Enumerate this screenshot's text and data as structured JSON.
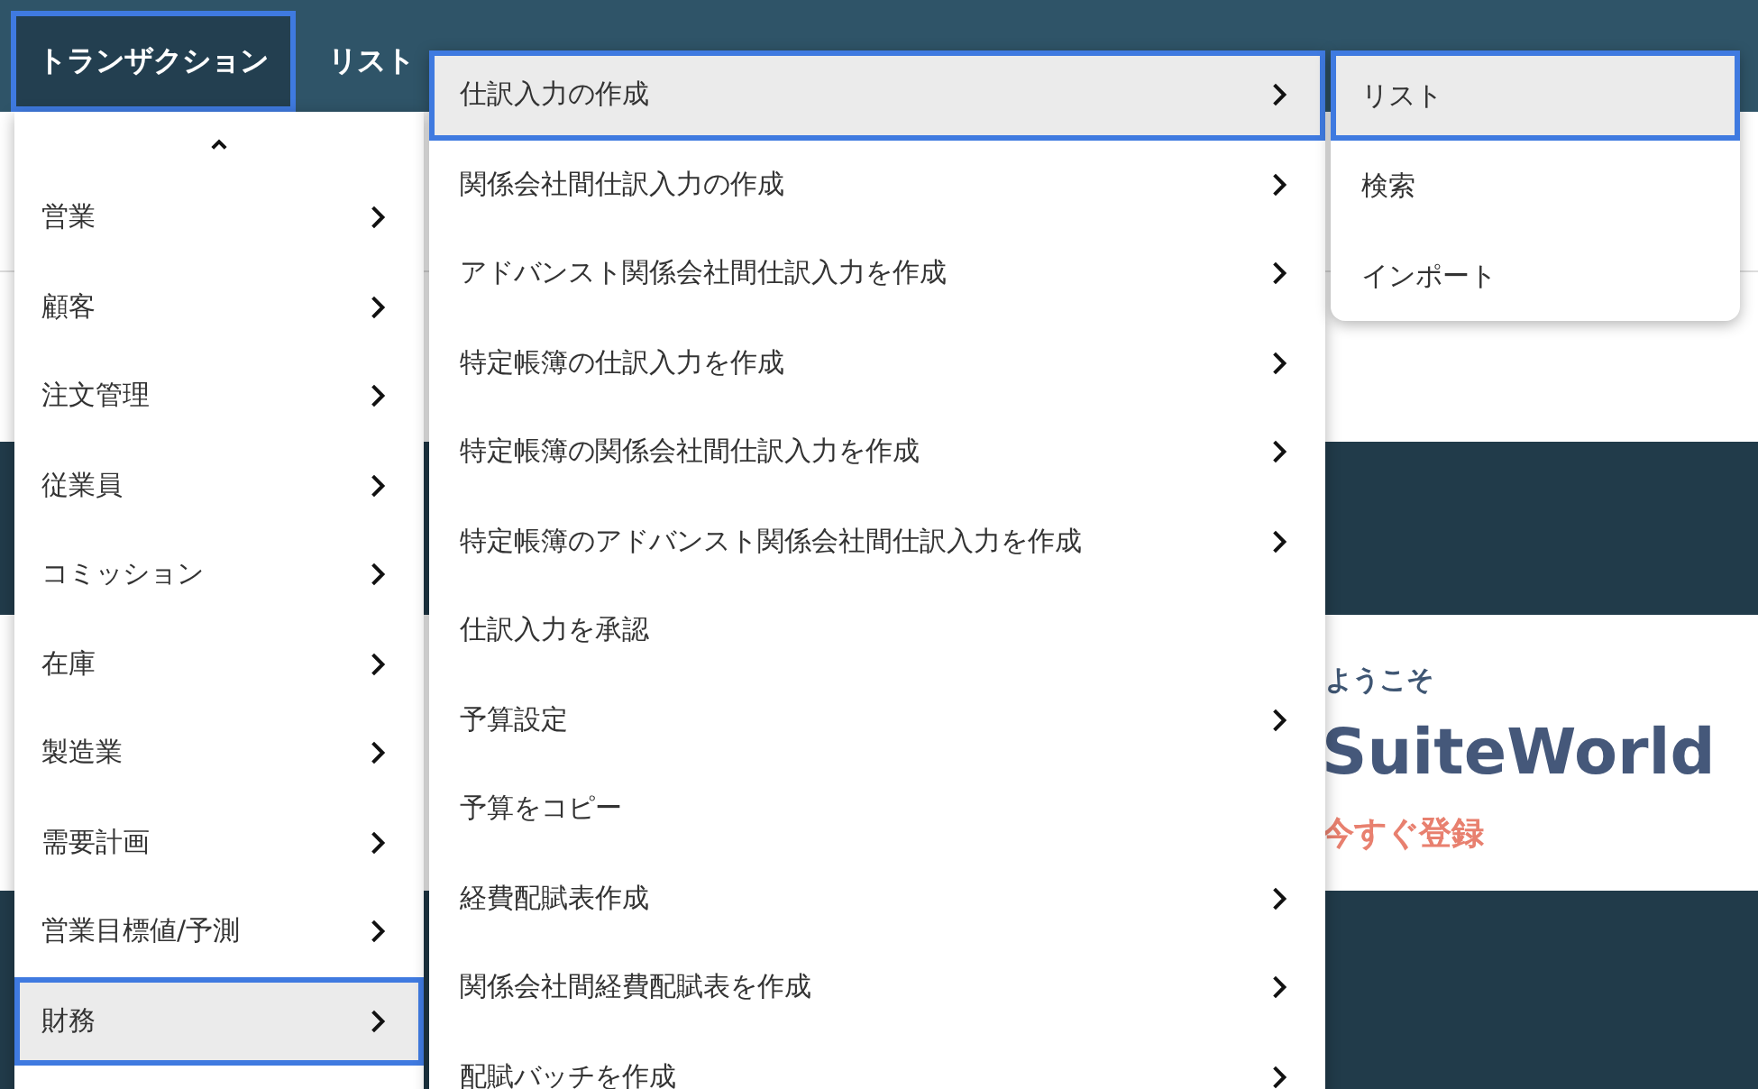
{
  "nav": {
    "items": [
      {
        "label": "トランザクション",
        "selected": true,
        "highlighted": true
      },
      {
        "label": "リスト",
        "selected": false,
        "highlighted": false
      }
    ]
  },
  "page": {
    "welcome": "ようこそ",
    "title": "SuiteWorld",
    "cta": "今すぐ登録"
  },
  "menu": {
    "items": [
      {
        "label": "営業",
        "selected": false,
        "highlighted": false,
        "has_submenu": true
      },
      {
        "label": "顧客",
        "selected": false,
        "highlighted": false,
        "has_submenu": true
      },
      {
        "label": "注文管理",
        "selected": false,
        "highlighted": false,
        "has_submenu": true
      },
      {
        "label": "従業員",
        "selected": false,
        "highlighted": false,
        "has_submenu": true
      },
      {
        "label": "コミッション",
        "selected": false,
        "highlighted": false,
        "has_submenu": true
      },
      {
        "label": "在庫",
        "selected": false,
        "highlighted": false,
        "has_submenu": true
      },
      {
        "label": "製造業",
        "selected": false,
        "highlighted": false,
        "has_submenu": true
      },
      {
        "label": "需要計画",
        "selected": false,
        "highlighted": false,
        "has_submenu": true
      },
      {
        "label": "営業目標値/予測",
        "selected": false,
        "highlighted": false,
        "has_submenu": true
      },
      {
        "label": "財務",
        "selected": true,
        "highlighted": true,
        "has_submenu": true
      }
    ]
  },
  "submenu": {
    "items": [
      {
        "label": "仕訳入力の作成",
        "selected": true,
        "highlighted": true,
        "has_submenu": true
      },
      {
        "label": "関係会社間仕訳入力の作成",
        "selected": false,
        "highlighted": false,
        "has_submenu": true
      },
      {
        "label": "アドバンスト関係会社間仕訳入力を作成",
        "selected": false,
        "highlighted": false,
        "has_submenu": true
      },
      {
        "label": "特定帳簿の仕訳入力を作成",
        "selected": false,
        "highlighted": false,
        "has_submenu": true
      },
      {
        "label": "特定帳簿の関係会社間仕訳入力を作成",
        "selected": false,
        "highlighted": false,
        "has_submenu": true
      },
      {
        "label": "特定帳簿のアドバンスト関係会社間仕訳入力を作成",
        "selected": false,
        "highlighted": false,
        "has_submenu": true
      },
      {
        "label": "仕訳入力を承認",
        "selected": false,
        "highlighted": false,
        "has_submenu": false
      },
      {
        "label": "予算設定",
        "selected": false,
        "highlighted": false,
        "has_submenu": true
      },
      {
        "label": "予算をコピー",
        "selected": false,
        "highlighted": false,
        "has_submenu": false
      },
      {
        "label": "経費配賦表作成",
        "selected": false,
        "highlighted": false,
        "has_submenu": true
      },
      {
        "label": "関係会社間経費配賦表を作成",
        "selected": false,
        "highlighted": false,
        "has_submenu": true
      },
      {
        "label": "配賦バッチを作成",
        "selected": false,
        "highlighted": false,
        "has_submenu": true
      }
    ]
  },
  "flyout": {
    "items": [
      {
        "label": "リスト",
        "selected": true,
        "highlighted": true
      },
      {
        "label": "検索",
        "selected": false,
        "highlighted": false
      },
      {
        "label": "インポート",
        "selected": false,
        "highlighted": false
      }
    ]
  }
}
